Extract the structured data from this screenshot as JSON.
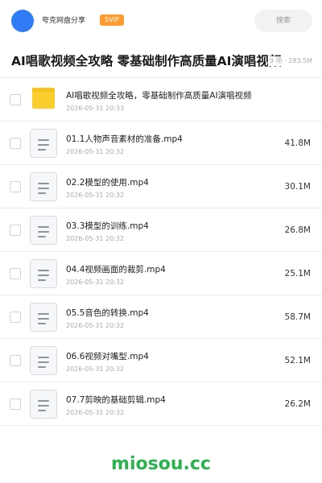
{
  "header": {
    "share_name": "夸克网盘分享",
    "vip_label": "SVIP",
    "search_placeholder": "搜索",
    "avatar_color": "#2f7cf6"
  },
  "title": {
    "text": "AI唱歌视频全攻略 零基础制作高质量AI演唱视频",
    "meta": "9 项 · 283.5M"
  },
  "items": [
    {
      "type": "folder",
      "icon": "folder-icon",
      "name": "AI唱歌视频全攻略，零基础制作高质量AI演唱视频",
      "date": "2026-05-31 20:33",
      "size": ""
    },
    {
      "type": "file",
      "icon": "file-icon",
      "name": "01.1人物声音素材的准备.mp4",
      "date": "2026-05-31 20:32",
      "size": "41.8M"
    },
    {
      "type": "file",
      "icon": "file-icon",
      "name": "02.2模型的使用.mp4",
      "date": "2026-05-31 20:32",
      "size": "30.1M"
    },
    {
      "type": "file",
      "icon": "file-icon",
      "name": "03.3模型的训练.mp4",
      "date": "2026-05-31 20:32",
      "size": "26.8M"
    },
    {
      "type": "file",
      "icon": "file-icon",
      "name": "04.4视频画面的裁剪.mp4",
      "date": "2026-05-31 20:32",
      "size": "25.1M"
    },
    {
      "type": "file",
      "icon": "file-icon",
      "name": "05.5音色的转换.mp4",
      "date": "2026-05-31 20:32",
      "size": "58.7M"
    },
    {
      "type": "file",
      "icon": "file-icon",
      "name": "06.6视频对嘴型.mp4",
      "date": "2026-05-31 20:32",
      "size": "52.1M"
    },
    {
      "type": "file",
      "icon": "file-icon",
      "name": "07.7剪映的基础剪辑.mp4",
      "date": "2026-05-31 20:32",
      "size": "26.2M"
    }
  ],
  "footer": {
    "brand": "miosou.cc",
    "brand_color": "#2bb24c"
  }
}
